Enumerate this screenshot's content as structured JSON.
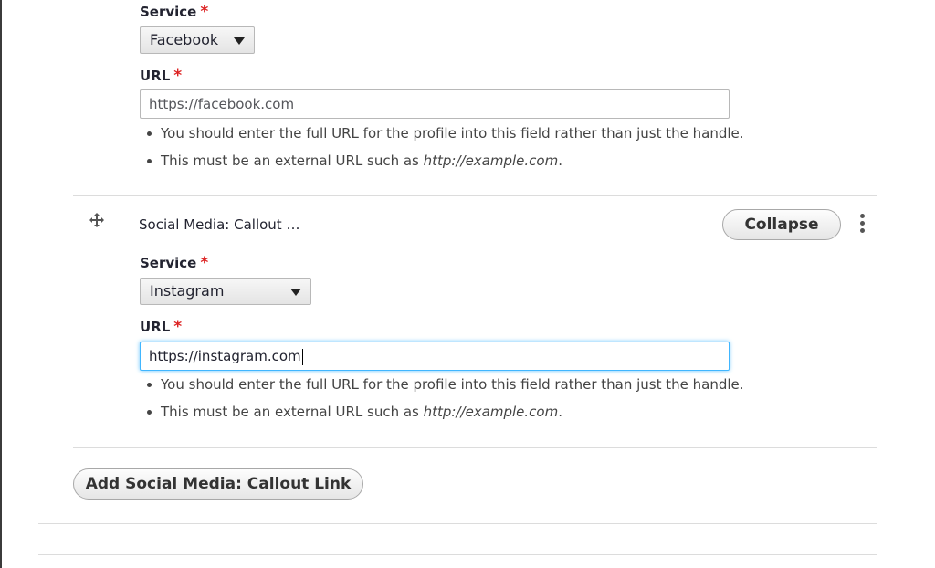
{
  "item1": {
    "service_label": "Service",
    "service_required": "*",
    "service_value": "Facebook",
    "url_label": "URL",
    "url_required": "*",
    "url_value": "https://facebook.com",
    "desc1": "You should enter the full URL for the profile into this field rather than just the handle.",
    "desc2_prefix": "This must be an external URL such as ",
    "desc2_example": "http://example.com",
    "desc2_suffix": "."
  },
  "item2": {
    "title": "Social Media: Callout …",
    "collapse_label": "Collapse",
    "service_label": "Service",
    "service_required": "*",
    "service_value": "Instagram",
    "url_label": "URL",
    "url_required": "*",
    "url_value": "https://instagram.com",
    "desc1": "You should enter the full URL for the profile into this field rather than just the handle.",
    "desc2_prefix": "This must be an external URL such as ",
    "desc2_example": "http://example.com",
    "desc2_suffix": "."
  },
  "add_button_label": "Add Social Media: Callout Link",
  "icons": {
    "drag": "drag-handle-icon",
    "more": "more-vertical-icon",
    "caret": "chevron-down-icon"
  },
  "colors": {
    "required": "#dc2323",
    "focus": "#40b6ff"
  }
}
